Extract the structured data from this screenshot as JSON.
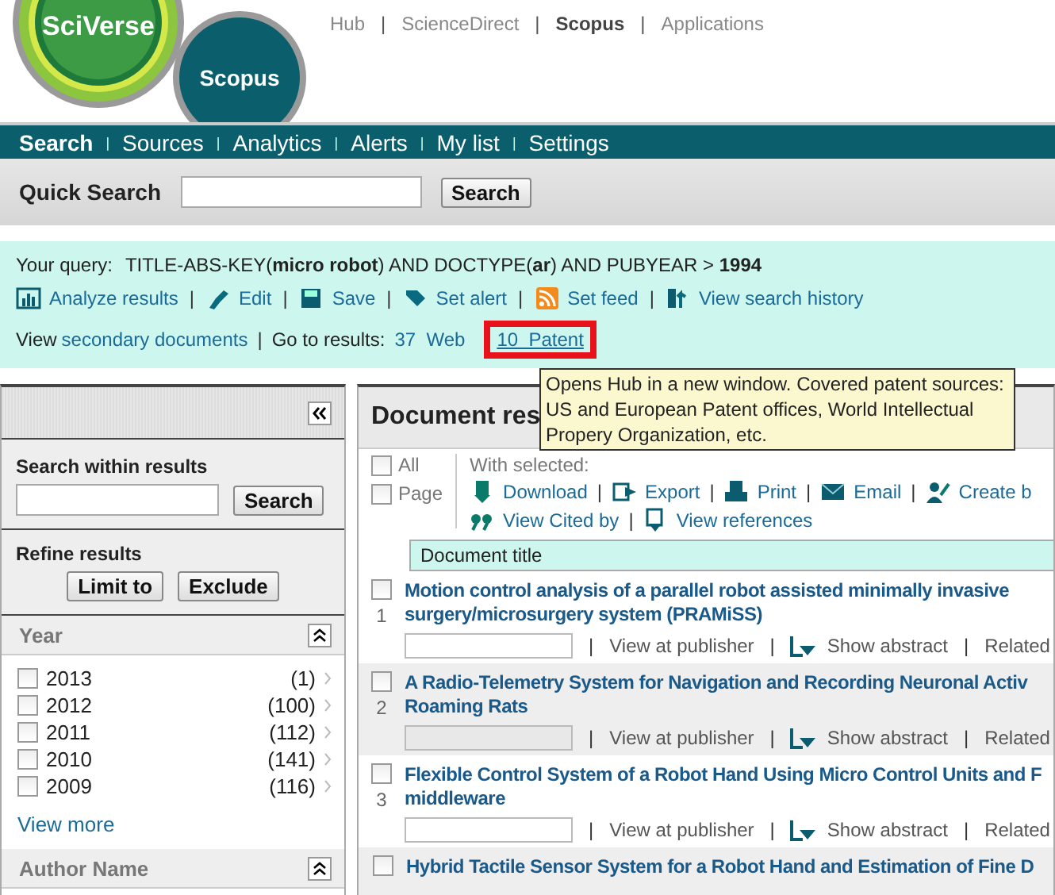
{
  "logo": {
    "brand": "SciVerse",
    "product": "Scopus"
  },
  "top_links": [
    {
      "label": "Hub",
      "selected": false
    },
    {
      "sep": "|",
      "label": "ScienceDirect",
      "selected": false
    },
    {
      "sep": "|",
      "label": "Scopus",
      "selected": true
    },
    {
      "sep": "|",
      "label": "Applications",
      "selected": false
    }
  ],
  "nav_tabs": [
    {
      "label": "Search",
      "selected": true
    },
    {
      "sep": "|",
      "label": "Sources",
      "selected": false
    },
    {
      "sep": "|",
      "label": "Analytics",
      "selected": false
    },
    {
      "sep": "|",
      "label": "Alerts",
      "selected": false
    },
    {
      "sep": "|",
      "label": "My list",
      "selected": false
    },
    {
      "sep": "|",
      "label": "Settings",
      "selected": false
    }
  ],
  "quick_search": {
    "label": "Quick Search",
    "button": "Search"
  },
  "query": {
    "label": "Your query:",
    "text": "TITLE-ABS-KEY(**micro robot**) AND DOCTYPE(**ar**) AND PUBYEAR > **1994**"
  },
  "actions": [
    {
      "label": "Analyze results",
      "kind": "chart"
    },
    {
      "sep": "|",
      "label": "Edit",
      "kind": "edit"
    },
    {
      "sep": "|",
      "label": "Save",
      "kind": "save"
    },
    {
      "sep": "|",
      "label": "Set alert",
      "kind": "alert"
    },
    {
      "sep": "|",
      "label": "Set feed",
      "kind": "feed"
    },
    {
      "sep": "|",
      "label": "View search history",
      "kind": "history"
    }
  ],
  "view_row": {
    "prefix": "View",
    "link": "secondary documents",
    "sep": "|",
    "goto_label": "Go to results:",
    "web_link": "37  Web",
    "patent_link": "10  Patent",
    "patent_highlighted": true
  },
  "tooltip": {
    "text": "Opens Hub in a new window. Covered patent sources: US and European Patent offices, World Intellectual Propery Organization, etc."
  },
  "sidebar": {
    "search_label": "Search within results",
    "search_button": "Search",
    "refine_label": "Refine results",
    "refine_buttons": [
      "Limit to",
      "Exclude"
    ],
    "facets": [
      {
        "title": "Year",
        "items": [
          {
            "label": "2013",
            "count": "(1)",
            "checked": false
          },
          {
            "label": "2012",
            "count": "(100)",
            "checked": false
          },
          {
            "label": "2011",
            "count": "(112)",
            "checked": false
          },
          {
            "label": "2010",
            "count": "(141)",
            "checked": false
          },
          {
            "label": "2009",
            "count": "(116)",
            "checked": false
          }
        ],
        "more": "View more"
      },
      {
        "title": "Author Name"
      }
    ]
  },
  "results": {
    "heading": "Document res",
    "select": [
      {
        "label": "All",
        "checked": false
      },
      {
        "label": "Page",
        "checked": false
      }
    ],
    "with_selected": "With selected:",
    "tools": [
      {
        "label": "Download",
        "kind": "download"
      },
      {
        "sep": "|",
        "label": "Export",
        "kind": "export"
      },
      {
        "sep": "|",
        "label": "Print",
        "kind": "print"
      },
      {
        "sep": "|",
        "label": "Email",
        "kind": "email"
      },
      {
        "sep": "|",
        "label": "Create b",
        "kind": "create"
      }
    ],
    "tools2": [
      {
        "label": "View Cited by",
        "kind": "cited"
      },
      {
        "sep": "|",
        "label": "View references",
        "kind": "references"
      }
    ],
    "column": "Document title",
    "rows": [
      {
        "number": "1",
        "checked": false,
        "title_lines": [
          "Motion control analysis of a parallel robot assisted minimally invasive",
          "surgery/microsurgery system (PRAMiSS)"
        ],
        "links": [
          {
            "sep": "|",
            "label": "View at publisher"
          },
          {
            "sep": "|",
            "label": "Show abstract"
          },
          {
            "sep": "|",
            "label": "Related"
          }
        ]
      },
      {
        "number": "2",
        "checked": false,
        "title_lines": [
          "A Radio-Telemetry System for Navigation and Recording Neuronal Activ",
          "Roaming Rats"
        ],
        "links": [
          {
            "sep": "|",
            "label": "View at publisher"
          },
          {
            "sep": "|",
            "label": "Show abstract"
          },
          {
            "sep": "|",
            "label": "Related"
          }
        ]
      },
      {
        "number": "3",
        "checked": false,
        "title_lines": [
          "Flexible Control System of a Robot Hand Using Micro Control Units and F",
          "middleware"
        ],
        "links": [
          {
            "sep": "|",
            "label": "View at publisher"
          },
          {
            "sep": "|",
            "label": "Show abstract"
          },
          {
            "sep": "|",
            "label": "Related"
          }
        ]
      },
      {
        "checked": false,
        "title_lines": [
          "Hybrid Tactile Sensor System for a Robot Hand and Estimation of Fine D"
        ]
      }
    ]
  }
}
